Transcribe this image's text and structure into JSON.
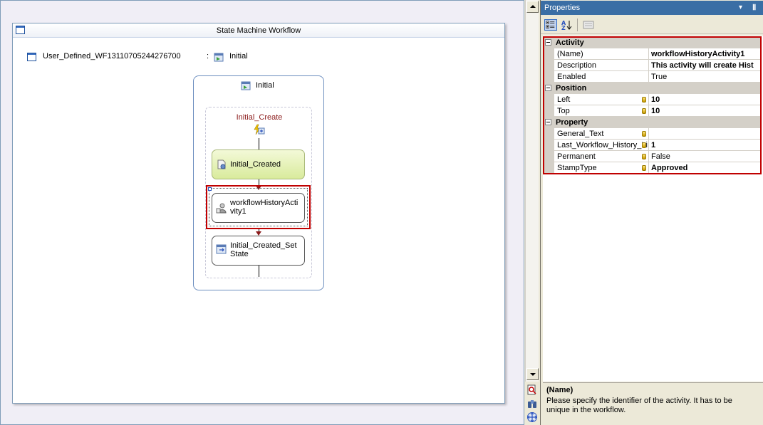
{
  "designer": {
    "window_title": "State Machine Workflow",
    "root_name": "User_Defined_WF13110705244276700",
    "root_separator": ":",
    "root_initial_state": "Initial",
    "state": {
      "name": "Initial",
      "event_driven": "Initial_Create",
      "activities": [
        {
          "name": "Initial_Created"
        },
        {
          "name": "workflowHistoryActivity1"
        },
        {
          "name": "Initial_Created_SetState"
        }
      ]
    }
  },
  "properties": {
    "title": "Properties",
    "dropdown_glyph": "▾",
    "pin_glyph": "Ⅱ",
    "categories": [
      {
        "name": "Activity",
        "rows": [
          {
            "name": "(Name)",
            "value": "workflowHistoryActivity1",
            "bold": true
          },
          {
            "name": "Description",
            "value": "This activity will create Hist",
            "bold": true
          },
          {
            "name": "Enabled",
            "value": "True",
            "bold": false
          }
        ]
      },
      {
        "name": "Position",
        "rows": [
          {
            "name": "Left",
            "value": "10",
            "bold": true
          },
          {
            "name": "Top",
            "value": "10",
            "bold": true
          }
        ]
      },
      {
        "name": "Property",
        "rows": [
          {
            "name": "General_Text",
            "value": "",
            "bold": false
          },
          {
            "name": "Last_Workflow_History_Li",
            "value": "1",
            "bold": true
          },
          {
            "name": "Permanent",
            "value": "False",
            "bold": false
          },
          {
            "name": "StampType",
            "value": "Approved",
            "bold": true
          }
        ]
      }
    ],
    "description": {
      "title": "(Name)",
      "text": "Please specify the identifier of the activity. It has to be unique in the workflow."
    }
  },
  "colors": {
    "selection_outline": "#c00000",
    "panel_title": "#3a6ea5",
    "event_label": "#8b1a1a",
    "created_activity_fill": "#d9eb9c"
  }
}
